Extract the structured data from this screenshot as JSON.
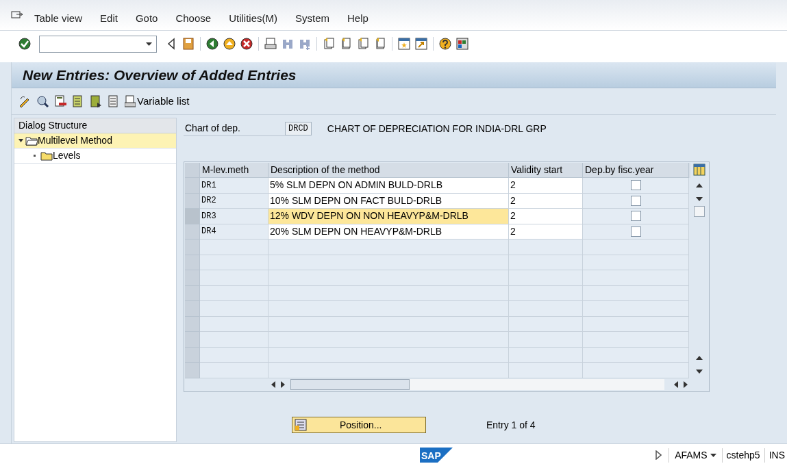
{
  "menu": [
    "Table view",
    "Edit",
    "Goto",
    "Choose",
    "Utilities(M)",
    "System",
    "Help"
  ],
  "title": "New Entries: Overview of Added Entries",
  "app_toolbar": {
    "variable_list": "Variable list"
  },
  "dialog_structure": {
    "heading": "Dialog Structure",
    "items": [
      {
        "label": "Multilevel Method",
        "expanded": true,
        "selected": true,
        "children": [
          {
            "label": "Levels",
            "selected": false
          }
        ]
      }
    ]
  },
  "chart_of_dep": {
    "label": "Chart of dep.",
    "value": "DRCD",
    "description": "CHART OF DEPRECIATION FOR INDIA-DRL GRP"
  },
  "table": {
    "columns": [
      "M-lev.meth",
      "Description of the method",
      "Validity start",
      "Dep.by fisc.year"
    ],
    "rows": [
      {
        "method": "DR1",
        "description": "5% SLM DEPN ON ADMIN BULD-DRLB",
        "validity_start": "2",
        "dep_by_fisc_year": false,
        "selected": false
      },
      {
        "method": "DR2",
        "description": "10% SLM DEPN ON FACT BULD-DRLB",
        "validity_start": "2",
        "dep_by_fisc_year": false,
        "selected": false
      },
      {
        "method": "DR3",
        "description": "12% WDV DEPN ON NON HEAVYP&M-DRLB",
        "validity_start": "2",
        "dep_by_fisc_year": false,
        "selected": true
      },
      {
        "method": "DR4",
        "description": "20% SLM DEPN ON HEAVYP&M-DRLB",
        "validity_start": "2",
        "dep_by_fisc_year": false,
        "selected": false
      }
    ]
  },
  "position_button": "Position...",
  "entry_count": "Entry 1 of 4",
  "logo": "SAP",
  "status_bar": {
    "transaction": "AFAMS",
    "server": "cstehp5",
    "mode": "INS"
  }
}
